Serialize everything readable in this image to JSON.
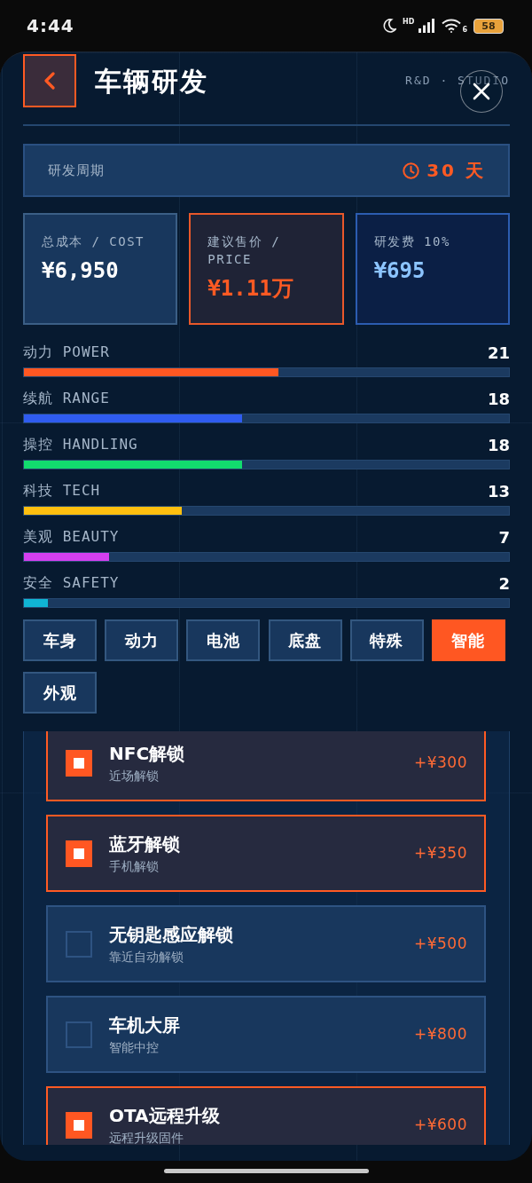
{
  "status_bar": {
    "time": "4:44",
    "network_label": "HD",
    "wifi_label": "6",
    "battery": "58"
  },
  "header": {
    "title": "车辆研发",
    "subtitle": "R&D · STUDIO"
  },
  "duration": {
    "label": "研发周期",
    "value": "30 天"
  },
  "summary_cards": [
    {
      "kind": "cost",
      "label": "总成本 / COST",
      "value": "¥6,950"
    },
    {
      "kind": "price",
      "label": "建议售价 / PRICE",
      "value": "¥1.11万"
    },
    {
      "kind": "fee",
      "label": "研发费 10%",
      "value": "¥695"
    }
  ],
  "stats": [
    {
      "label": "动力 POWER",
      "value": "21",
      "level": 0.525,
      "color": "#ff5722"
    },
    {
      "label": "续航 RANGE",
      "value": "18",
      "level": 0.45,
      "color": "#2f5cf0"
    },
    {
      "label": "操控 HANDLING",
      "value": "18",
      "level": 0.45,
      "color": "#12dc6e"
    },
    {
      "label": "科技 TECH",
      "value": "13",
      "level": 0.325,
      "color": "#ffbf0f"
    },
    {
      "label": "美观 BEAUTY",
      "value": "7",
      "level": 0.175,
      "color": "#d53ff0"
    },
    {
      "label": "安全 SAFETY",
      "value": "2",
      "level": 0.05,
      "color": "#10b5d5"
    }
  ],
  "tabs": [
    {
      "label": "车身",
      "selected": false
    },
    {
      "label": "动力",
      "selected": false
    },
    {
      "label": "电池",
      "selected": false
    },
    {
      "label": "底盘",
      "selected": false
    },
    {
      "label": "特殊",
      "selected": false
    },
    {
      "label": "智能",
      "selected": true
    },
    {
      "label": "外观",
      "selected": false
    }
  ],
  "options": [
    {
      "name": "NFC解锁",
      "description": "近场解锁",
      "price": "+¥300",
      "checked": true
    },
    {
      "name": "蓝牙解锁",
      "description": "手机解锁",
      "price": "+¥350",
      "checked": true
    },
    {
      "name": "无钥匙感应解锁",
      "description": "靠近自动解锁",
      "price": "+¥500",
      "checked": false
    },
    {
      "name": "车机大屏",
      "description": "智能中控",
      "price": "+¥800",
      "checked": false
    },
    {
      "name": "OTA远程升级",
      "description": "远程升级固件",
      "price": "+¥600",
      "checked": true
    }
  ]
}
